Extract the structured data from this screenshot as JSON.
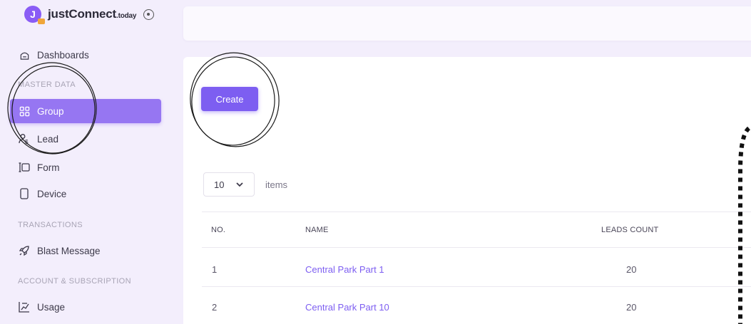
{
  "brand": {
    "badge_letter": "J",
    "name": "justConnect",
    "suffix": ".today",
    "accent": "#7d5ef1"
  },
  "sidebar": {
    "items": [
      {
        "label": "Dashboards",
        "icon": "home-icon"
      },
      {
        "label": "Group",
        "icon": "grid-icon",
        "active": true
      },
      {
        "label": "Lead",
        "icon": "user-dollar-icon"
      },
      {
        "label": "Form",
        "icon": "form-input-icon"
      },
      {
        "label": "Device",
        "icon": "device-icon"
      },
      {
        "label": "Blast Message",
        "icon": "rocket-icon"
      },
      {
        "label": "Usage",
        "icon": "usage-chart-icon"
      }
    ],
    "sections": {
      "master_data": "MASTER DATA",
      "transactions": "TRANSACTIONS",
      "account": "ACCOUNT & SUBSCRIPTION"
    }
  },
  "main": {
    "create_label": "Create",
    "per_page_value": "10",
    "items_label": "items",
    "table": {
      "columns": [
        "NO.",
        "NAME",
        "LEADS COUNT"
      ],
      "rows": [
        {
          "no": "1",
          "name": "Central Park Part 1",
          "leads": "20"
        },
        {
          "no": "2",
          "name": "Central Park Part 10",
          "leads": "20"
        }
      ]
    }
  }
}
